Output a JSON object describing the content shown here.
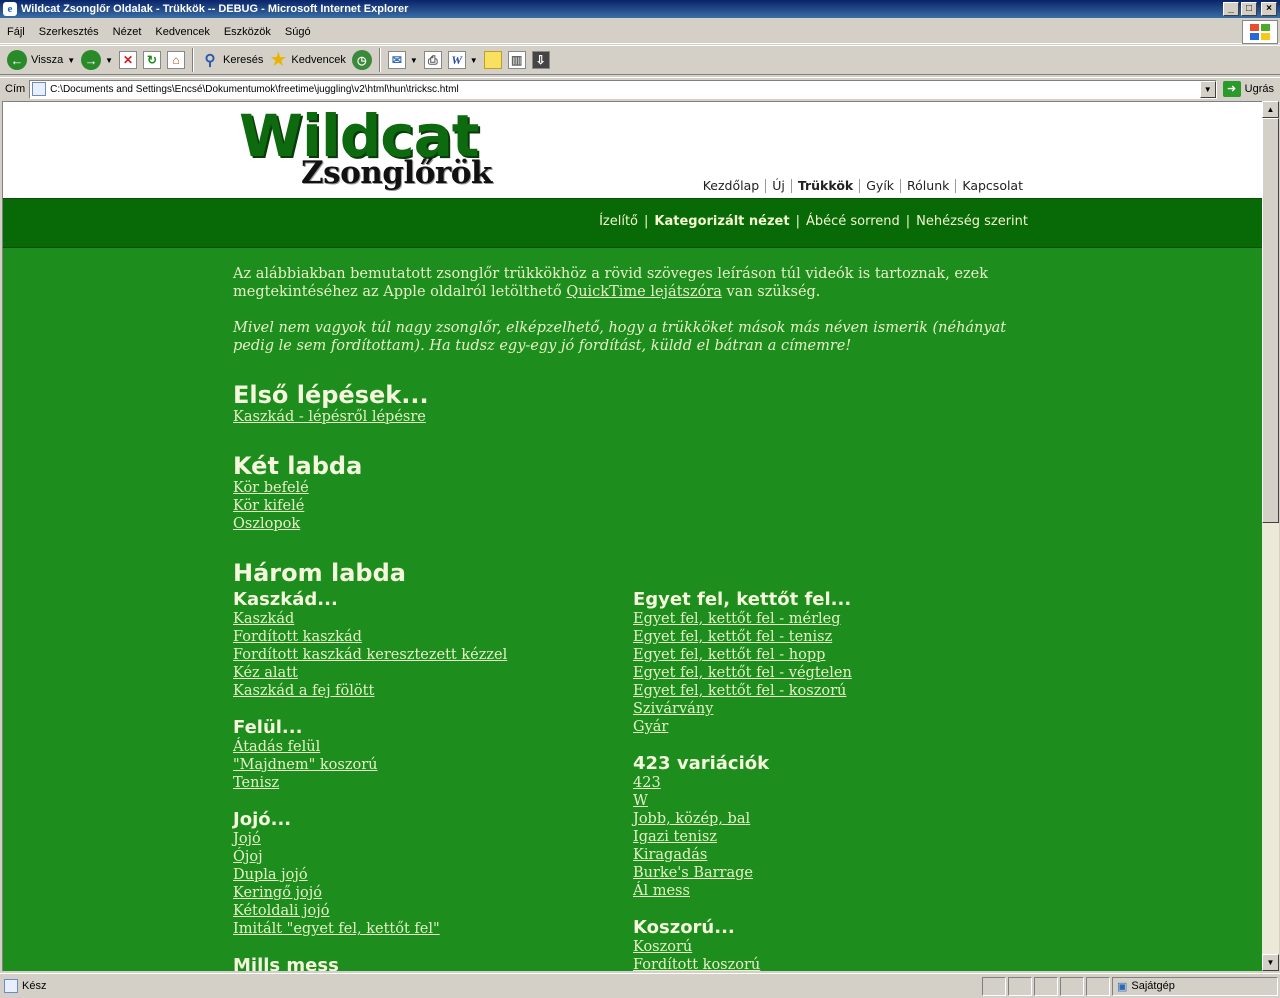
{
  "window": {
    "title": "Wildcat Zsonglőr Oldalak - Trükkök -- DEBUG - Microsoft Internet Explorer"
  },
  "menu": [
    "Fájl",
    "Szerkesztés",
    "Nézet",
    "Kedvencek",
    "Eszközök",
    "Súgó"
  ],
  "toolbar": {
    "back": "Vissza",
    "search": "Keresés",
    "favorites": "Kedvencek"
  },
  "address": {
    "label": "Cím",
    "value": "C:\\Documents and Settings\\Encsé\\Dokumentumok\\freetime\\juggling\\v2\\html\\hun\\tricksc.html",
    "go": "Ugrás"
  },
  "status": {
    "text": "Kész",
    "zone": "Sajátgép"
  },
  "site": {
    "logo_main": "Wildcat",
    "logo_sub": "Zsonglőrök",
    "topnav": [
      "Kezdőlap",
      "Új",
      "Trükkök",
      "Gyík",
      "Rólunk",
      "Kapcsolat"
    ],
    "subnav": [
      "Ízelítő",
      "Kategorizált nézet",
      "Ábécé sorrend",
      "Nehézség szerint"
    ]
  },
  "intro": {
    "p1_before": "Az alábbiakban bemutatott zsonglőr trükkökhöz a rövid szöveges leíráson túl videók is tartoznak, ezek megtekintéséhez az Apple oldalról letölthető ",
    "p1_link": "QuickTime lejátszóra",
    "p1_after": " van szükség.",
    "p2": "Mivel nem vagyok túl nagy zsonglőr, elképzelhető, hogy a trükköket mások más néven ismerik (néhányat pedig le sem fordítottam). Ha tudsz egy-egy jó fordítást, küldd el bátran a címemre!"
  },
  "sections": {
    "first": {
      "title": "Első lépések...",
      "links": [
        "Kaszkád - lépésről lépésre"
      ]
    },
    "two": {
      "title": "Két labda",
      "links": [
        "Kör befelé",
        "Kör kifelé",
        "Oszlopok"
      ]
    },
    "three": {
      "title": "Három labda",
      "left": [
        {
          "title": "Kaszkád...",
          "links": [
            "Kaszkád",
            "Fordított kaszkád",
            "Fordított kaszkád keresztezett kézzel",
            "Kéz alatt",
            "Kaszkád a fej fölött"
          ]
        },
        {
          "title": "Felül...",
          "links": [
            "Átadás felül",
            "\"Majdnem\" koszorú",
            "Tenisz"
          ]
        },
        {
          "title": "Jojó...",
          "links": [
            "Jojó",
            "Ójoj",
            "Dupla jojó",
            "Keringő jojó",
            "Kétoldali jojó",
            "Imitált \"egyet fel, kettőt fel\""
          ]
        },
        {
          "title": "Mills mess",
          "links": []
        }
      ],
      "right": [
        {
          "title": "Egyet fel, kettőt fel...",
          "links": [
            "Egyet fel, kettőt fel - mérleg",
            "Egyet fel, kettőt fel - tenisz",
            "Egyet fel, kettőt fel - hopp",
            "Egyet fel, kettőt fel - végtelen",
            "Egyet fel, kettőt fel - koszorú",
            "Szivárvány",
            "Gyár"
          ]
        },
        {
          "title": "423 variációk",
          "links": [
            "423",
            "W",
            "Jobb, közép, bal",
            "Igazi tenisz",
            "Kiragadás",
            "Burke's Barrage",
            "Ál mess"
          ]
        },
        {
          "title": "Koszorú...",
          "links": [
            "Koszorú",
            "Fordított koszorú"
          ]
        }
      ]
    }
  }
}
